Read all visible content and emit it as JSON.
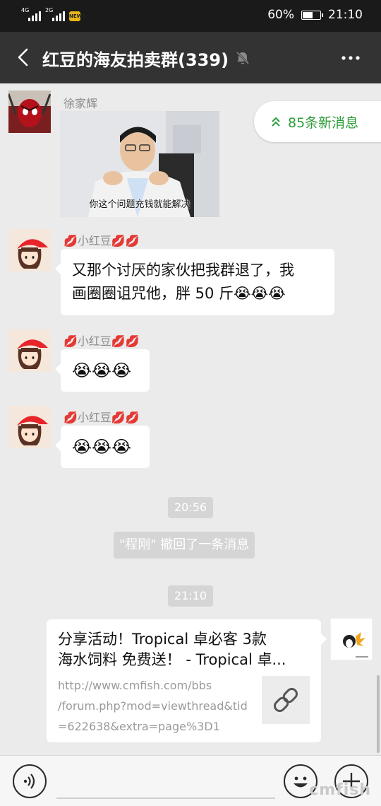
{
  "status_bar": {
    "net1": "4G",
    "net2": "2G",
    "app_badge": "NEWS",
    "battery": "60%",
    "battery_level": 0.6,
    "time": "21:10"
  },
  "header": {
    "title": "红豆的海友拍卖群(339)",
    "back_icon": "chevron-left-icon",
    "mute_icon": "bell-muted-icon",
    "more_icon": "more-dots-icon"
  },
  "new_messages": {
    "label": "85条新消息",
    "icon": "double-chevron-up-icon"
  },
  "messages": [
    {
      "sender": "徐家辉",
      "type": "image",
      "caption": "你这个问题充钱就能解决"
    },
    {
      "sender": "💋小红豆💋💋",
      "type": "text",
      "text_line1": "又那个讨厌的家伙把我群退了，我",
      "text_line2": "画圈圈诅咒他，胖 50 斤😭😭😭"
    },
    {
      "sender": "💋小红豆💋💋",
      "type": "emoji",
      "text": "😭😭😭"
    },
    {
      "sender": "💋小红豆💋💋",
      "type": "emoji",
      "text": "😭😭😭"
    }
  ],
  "time_1": "20:56",
  "recall_notice": "\"程刚\" 撤回了一条消息",
  "time_2": "21:10",
  "link_card": {
    "title_line1": "分享活动！Tropical 卓必客 3款",
    "title_line2": "海水饲料 免费送！ - Tropical 卓...",
    "url_line1": "http://www.cmfish.com/bbs",
    "url_line2": "/forum.php?mod=viewthread&tid",
    "url_line3": "=622638&extra=page%3D1",
    "icon": "link-icon"
  },
  "bottom_bar": {
    "voice_icon": "voice-icon",
    "emoji_icon": "smiley-icon",
    "plus_icon": "plus-icon",
    "watermark": "cmfish"
  },
  "colors": {
    "header_bg": "#333333",
    "accent_green": "#2d9c3a",
    "chat_bg": "#ebebeb"
  }
}
